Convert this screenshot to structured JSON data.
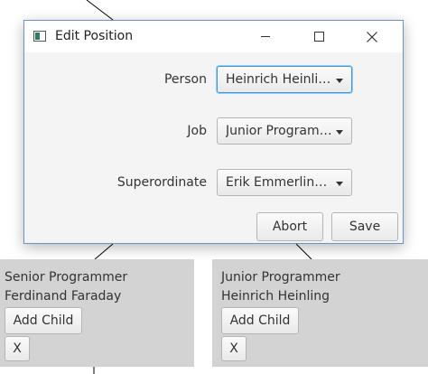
{
  "dialog": {
    "title": "Edit Position",
    "fields": [
      {
        "label": "Person",
        "value": "Heinrich Heinling"
      },
      {
        "label": "Job",
        "value": "Junior Programmer"
      },
      {
        "label": "Superordinate",
        "value": "Erik Emmerling T..."
      }
    ],
    "abort_label": "Abort",
    "save_label": "Save"
  },
  "nodes": [
    {
      "job": "Senior Programmer",
      "name": "Ferdinand Faraday",
      "add_child_label": "Add Child",
      "remove_label": "X"
    },
    {
      "job": "Junior Programmer",
      "name": "Heinrich Heinling",
      "add_child_label": "Add Child",
      "remove_label": "X"
    }
  ],
  "icons": {
    "app": "app-window-icon",
    "minimize": "minimize-icon",
    "maximize": "maximize-icon",
    "close": "close-icon",
    "combo_arrow": "dropdown-arrow-icon"
  },
  "colors": {
    "node_background": "#d3d3d3",
    "dialog_border": "#6a93c6",
    "focus_ring": "#3a9ad9"
  }
}
